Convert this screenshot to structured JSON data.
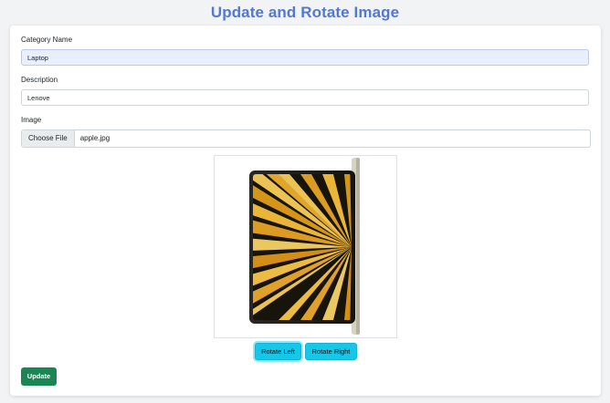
{
  "page": {
    "title": "Update and Rotate Image"
  },
  "form": {
    "category_label": "Category Name",
    "category_value": "Laptop",
    "description_label": "Description",
    "description_value": "Lenove",
    "image_label": "Image",
    "choose_file_label": "Choose File",
    "file_name": "apple.jpg"
  },
  "actions": {
    "rotate_left": "Rotate Left",
    "rotate_right": "Rotate Right",
    "update": "Update"
  },
  "colors": {
    "title": "#5577cc",
    "rotate_buttons": "#17c7ea",
    "update_button": "#198754",
    "filled_input": "#e8f0fe"
  }
}
